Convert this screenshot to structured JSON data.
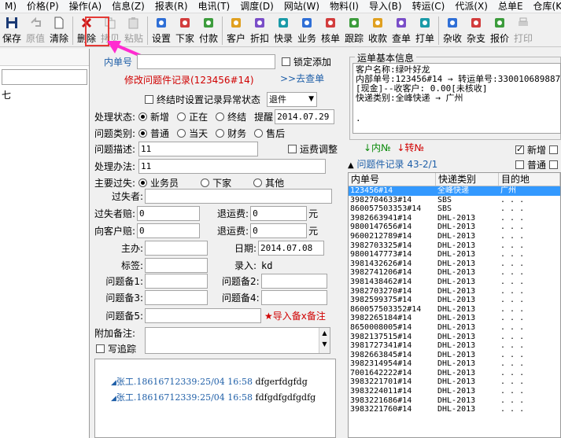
{
  "menu": [
    "M)",
    "价格(P)",
    "操作(A)",
    "信息(Z)",
    "报表(R)",
    "电讯(T)",
    "调度(D)",
    "网站(W)",
    "物料(I)",
    "导入(B)",
    "转运(C)",
    "代派(X)",
    "总单E",
    "仓库(K)"
  ],
  "toolbar": {
    "buttons": [
      {
        "label": "保存",
        "icon": "save-icon",
        "disabled": false
      },
      {
        "label": "原值",
        "icon": "undo-icon",
        "disabled": true
      },
      {
        "label": "清除",
        "icon": "new-doc-icon",
        "disabled": false
      },
      {
        "label": "删除",
        "icon": "delete-icon",
        "disabled": false
      },
      {
        "label": "拷贝",
        "icon": "copy-icon",
        "disabled": true
      },
      {
        "label": "粘贴",
        "icon": "paste-icon",
        "disabled": true
      },
      {
        "label": "设置",
        "icon": "settings-icon",
        "disabled": false
      },
      {
        "label": "下家",
        "icon": "people-icon",
        "disabled": false
      },
      {
        "label": "付款",
        "icon": "payment-icon",
        "disabled": false
      },
      {
        "label": "客户",
        "icon": "customer-icon",
        "disabled": false
      },
      {
        "label": "折扣",
        "icon": "discount-icon",
        "disabled": false
      },
      {
        "label": "快录",
        "icon": "quick-entry-icon",
        "disabled": false
      },
      {
        "label": "业务",
        "icon": "business-icon",
        "disabled": false
      },
      {
        "label": "核单",
        "icon": "verify-icon",
        "disabled": false
      },
      {
        "label": "跟踪",
        "icon": "track-icon",
        "disabled": false
      },
      {
        "label": "收款",
        "icon": "collect-icon",
        "disabled": false
      },
      {
        "label": "查单",
        "icon": "search-order-icon",
        "disabled": false
      },
      {
        "label": "打单",
        "icon": "print-order-icon",
        "disabled": false
      },
      {
        "label": "杂收",
        "icon": "misc-income-icon",
        "disabled": false
      },
      {
        "label": "杂支",
        "icon": "misc-expense-icon",
        "disabled": false
      },
      {
        "label": "报价",
        "icon": "quote-icon",
        "disabled": false
      },
      {
        "label": "打印",
        "icon": "print-icon",
        "disabled": true
      }
    ]
  },
  "left_panel": {
    "tree_item": "七"
  },
  "form": {
    "inner_no_label": "内单号",
    "inner_no_value": "",
    "lock_add_label": "锁定添加",
    "edit_title": "修改问题件记录(123456#14)",
    "goto_link": ">>去查单",
    "abnormal_label": "终结时设置记录异常状态",
    "abnormal_select": "退件",
    "status_label": "处理状态:",
    "status_options": [
      "新增",
      "正在",
      "终结"
    ],
    "remind_label": "提醒",
    "remind_date": "2014.07.29",
    "type_label": "问题类别:",
    "type_options": [
      "普通",
      "当天",
      "财务",
      "售后"
    ],
    "desc_label": "问题描述:",
    "desc_value": "11",
    "freight_adjust_label": "运费调整",
    "method_label": "处理办法:",
    "method_value": "11",
    "fault_label": "主要过失:",
    "fault_options": [
      "业务员",
      "下家",
      "其他"
    ],
    "fault_person_label": "过失者:",
    "fault_person_value": "",
    "fault_comp_label": "过失者赔:",
    "fault_comp_value": "0",
    "refund_label1": "退运费:",
    "refund_value1": "0",
    "yuan1": "元",
    "cust_comp_label": "向客户赔:",
    "cust_comp_value": "0",
    "refund_label2": "退运费:",
    "refund_value2": "0",
    "yuan2": "元",
    "owner_label": "主办:",
    "owner_value": "",
    "date_label": "日期:",
    "date_value": "2014.07.08",
    "tag_label": "标签:",
    "tag_value": "",
    "entry_label": "录入:",
    "entry_value": "kd",
    "note1_label": "问题备1:",
    "note2_label": "问题备2:",
    "note3_label": "问题备3:",
    "note4_label": "问题备4:",
    "note5_label": "问题备5:",
    "import_note_link": "★导入备x备注",
    "extra_label": "附加备注:",
    "write_track_label": "写追踪"
  },
  "log": [
    {
      "who": "张工.18616712339:25/04 16:58",
      "text": " dfgerfdgfdg"
    },
    {
      "who": "张工.18616712339:25/04 16:58",
      "text": " fdfgdfgdfgdfg"
    }
  ],
  "waybill": {
    "title": "运单基本信息",
    "lines": [
      "客户名称:绿叶好龙",
      "内部单号:123456#14 → 转运单号:330010689887",
      "[现金]--收客户: 0.00[未核收]",
      "快递类别:全峰快递 → 广州",
      "."
    ]
  },
  "list_controls": {
    "inner_no": "↓内№",
    "transfer_no": "↓转№",
    "new_label": "新增",
    "normal_label": "普通",
    "list_title": "问题件记录 43-2/1"
  },
  "grid": {
    "headers": [
      "内单号",
      "快递类别",
      "目的地"
    ],
    "rows": [
      [
        "123456#14",
        "全峰快递",
        "广州"
      ],
      [
        "3982704633#14",
        "SBS",
        ". . ."
      ],
      [
        "860057503353#14",
        "SBS",
        ". . ."
      ],
      [
        "3982663941#14",
        "DHL-2013",
        ". . ."
      ],
      [
        "9800147656#14",
        "DHL-2013",
        ". . ."
      ],
      [
        "9600212789#14",
        "DHL-2013",
        ". . ."
      ],
      [
        "3982703325#14",
        "DHL-2013",
        ". . ."
      ],
      [
        "9800147773#14",
        "DHL-2013",
        ". . ."
      ],
      [
        "3981432626#14",
        "DHL-2013",
        ". . ."
      ],
      [
        "3982741206#14",
        "DHL-2013",
        ". . ."
      ],
      [
        "3981438462#14",
        "DHL-2013",
        ". . ."
      ],
      [
        "3982703270#14",
        "DHL-2013",
        ". . ."
      ],
      [
        "3982599375#14",
        "DHL-2013",
        ". . ."
      ],
      [
        "860057503352#14",
        "DHL-2013",
        ". . ."
      ],
      [
        "3982265184#14",
        "DHL-2013",
        ". . ."
      ],
      [
        "8650008005#14",
        "DHL-2013",
        ". . ."
      ],
      [
        "3982137515#14",
        "DHL-2013",
        ". . ."
      ],
      [
        "3981727341#14",
        "DHL-2013",
        ". . ."
      ],
      [
        "3982663845#14",
        "DHL-2013",
        ". . ."
      ],
      [
        "3982314954#14",
        "DHL-2013",
        ". . ."
      ],
      [
        "7001642222#14",
        "DHL-2013",
        ". . ."
      ],
      [
        "3983221701#14",
        "DHL-2013",
        ". . ."
      ],
      [
        "3983224011#14",
        "DHL-2013",
        ". . ."
      ],
      [
        "3983221686#14",
        "DHL-2013",
        ". . ."
      ],
      [
        "3983221760#14",
        "DHL-2013",
        ". . ."
      ]
    ]
  },
  "colors": {
    "accent_red": "#d00000",
    "link_blue": "#1f5fa8",
    "selection": "#3399ff",
    "highlight_box": "#e53935",
    "arrow": "#ff2bd0"
  }
}
